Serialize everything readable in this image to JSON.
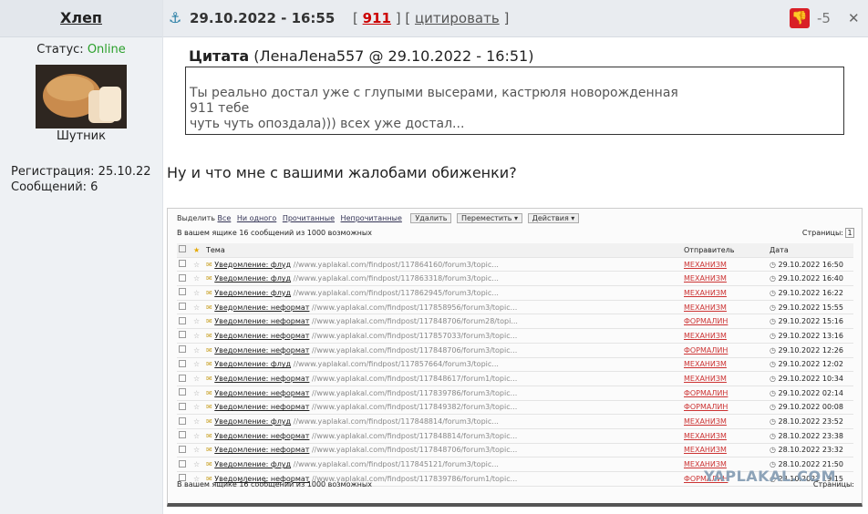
{
  "user": {
    "name": "Хлеп",
    "status_label": "Статус:",
    "status_value": "Online",
    "title": "Шутник",
    "reg": "Регистрация: 25.10.22",
    "posts": "Сообщений: 6"
  },
  "post": {
    "date": "29.10.2022 - 16:55",
    "num": "911",
    "quote_link": "цитировать",
    "score": "-5",
    "quote_label": "Цитата",
    "quote_meta": "(ЛенаЛена557 @ 29.10.2022 - 16:51)",
    "quote_lines": [
      "Ты реально достал уже с глупыми высерами, кастрюля новорожденная",
      "911 тебе",
      "чуть чуть опоздала))) всех уже достал..."
    ],
    "message": "Ну и что мне с вашими жалобами обиженки?"
  },
  "screenshot": {
    "select_label": "Выделить",
    "select_links": [
      "Все",
      "Ни одного",
      "Прочитанные",
      "Непрочитанные"
    ],
    "buttons": [
      "Удалить",
      "Переместить ▾",
      "Действия ▾"
    ],
    "info": "В вашем ящике 16 сообщений из 1000 возможных",
    "pages_label": "Страницы:",
    "page": "1",
    "col_subject": "Тема",
    "col_sender": "Отправитель",
    "col_date": "Дата",
    "rows": [
      {
        "s": "Уведомление: флуд",
        "u": "//www.yaplakal.com/findpost/117864160/forum3/topic...",
        "f": "МЕХАНИЗМ",
        "d": "29.10.2022 16:50"
      },
      {
        "s": "Уведомление: флуд",
        "u": "//www.yaplakal.com/findpost/117863318/forum3/topic...",
        "f": "МЕХАНИЗМ",
        "d": "29.10.2022 16:40"
      },
      {
        "s": "Уведомление: флуд",
        "u": "//www.yaplakal.com/findpost/117862945/forum3/topic...",
        "f": "МЕХАНИЗМ",
        "d": "29.10.2022 16:22"
      },
      {
        "s": "Уведомление: неформат",
        "u": "//www.yaplakal.com/findpost/117858956/forum3/topic...",
        "f": "МЕХАНИЗМ",
        "d": "29.10.2022 15:55"
      },
      {
        "s": "Уведомление: неформат",
        "u": "//www.yaplakal.com/findpost/117848706/forum28/topi...",
        "f": "ФОРМАЛИН",
        "d": "29.10.2022 15:16"
      },
      {
        "s": "Уведомление: неформат",
        "u": "//www.yaplakal.com/findpost/117857033/forum3/topic...",
        "f": "МЕХАНИЗМ",
        "d": "29.10.2022 13:16"
      },
      {
        "s": "Уведомление: неформат",
        "u": "//www.yaplakal.com/findpost/117848706/forum3/topic...",
        "f": "ФОРМАЛИН",
        "d": "29.10.2022 12:26"
      },
      {
        "s": "Уведомление: флуд",
        "u": "//www.yaplakal.com/findpost/117857664/forum3/topic...",
        "f": "МЕХАНИЗМ",
        "d": "29.10.2022 12:02"
      },
      {
        "s": "Уведомление: неформат",
        "u": "//www.yaplakal.com/findpost/117848617/forum1/topic...",
        "f": "МЕХАНИЗМ",
        "d": "29.10.2022 10:34"
      },
      {
        "s": "Уведомление: неформат",
        "u": "//www.yaplakal.com/findpost/117839786/forum3/topic...",
        "f": "ФОРМАЛИН",
        "d": "29.10.2022 02:14"
      },
      {
        "s": "Уведомление: неформат",
        "u": "//www.yaplakal.com/findpost/117849382/forum3/topic...",
        "f": "ФОРМАЛИН",
        "d": "29.10.2022 00:08"
      },
      {
        "s": "Уведомление: флуд",
        "u": "//www.yaplakal.com/findpost/117848814/forum3/topic...",
        "f": "МЕХАНИЗМ",
        "d": "28.10.2022 23:52"
      },
      {
        "s": "Уведомление: неформат",
        "u": "//www.yaplakal.com/findpost/117848814/forum3/topic...",
        "f": "МЕХАНИЗМ",
        "d": "28.10.2022 23:38"
      },
      {
        "s": "Уведомление: неформат",
        "u": "//www.yaplakal.com/findpost/117848706/forum3/topic...",
        "f": "МЕХАНИЗМ",
        "d": "28.10.2022 23:32"
      },
      {
        "s": "Уведомление: флуд",
        "u": "//www.yaplakal.com/findpost/117845121/forum3/topic...",
        "f": "МЕХАНИЗМ",
        "d": "28.10.2022 21:50"
      },
      {
        "s": "Уведомление: неформат",
        "u": "//www.yaplakal.com/findpost/117839786/forum1/topic...",
        "f": "ФОРМАЛИН",
        "d": "28.10.2022 19:15"
      }
    ],
    "watermark": "YAPLAKAL.COM"
  }
}
